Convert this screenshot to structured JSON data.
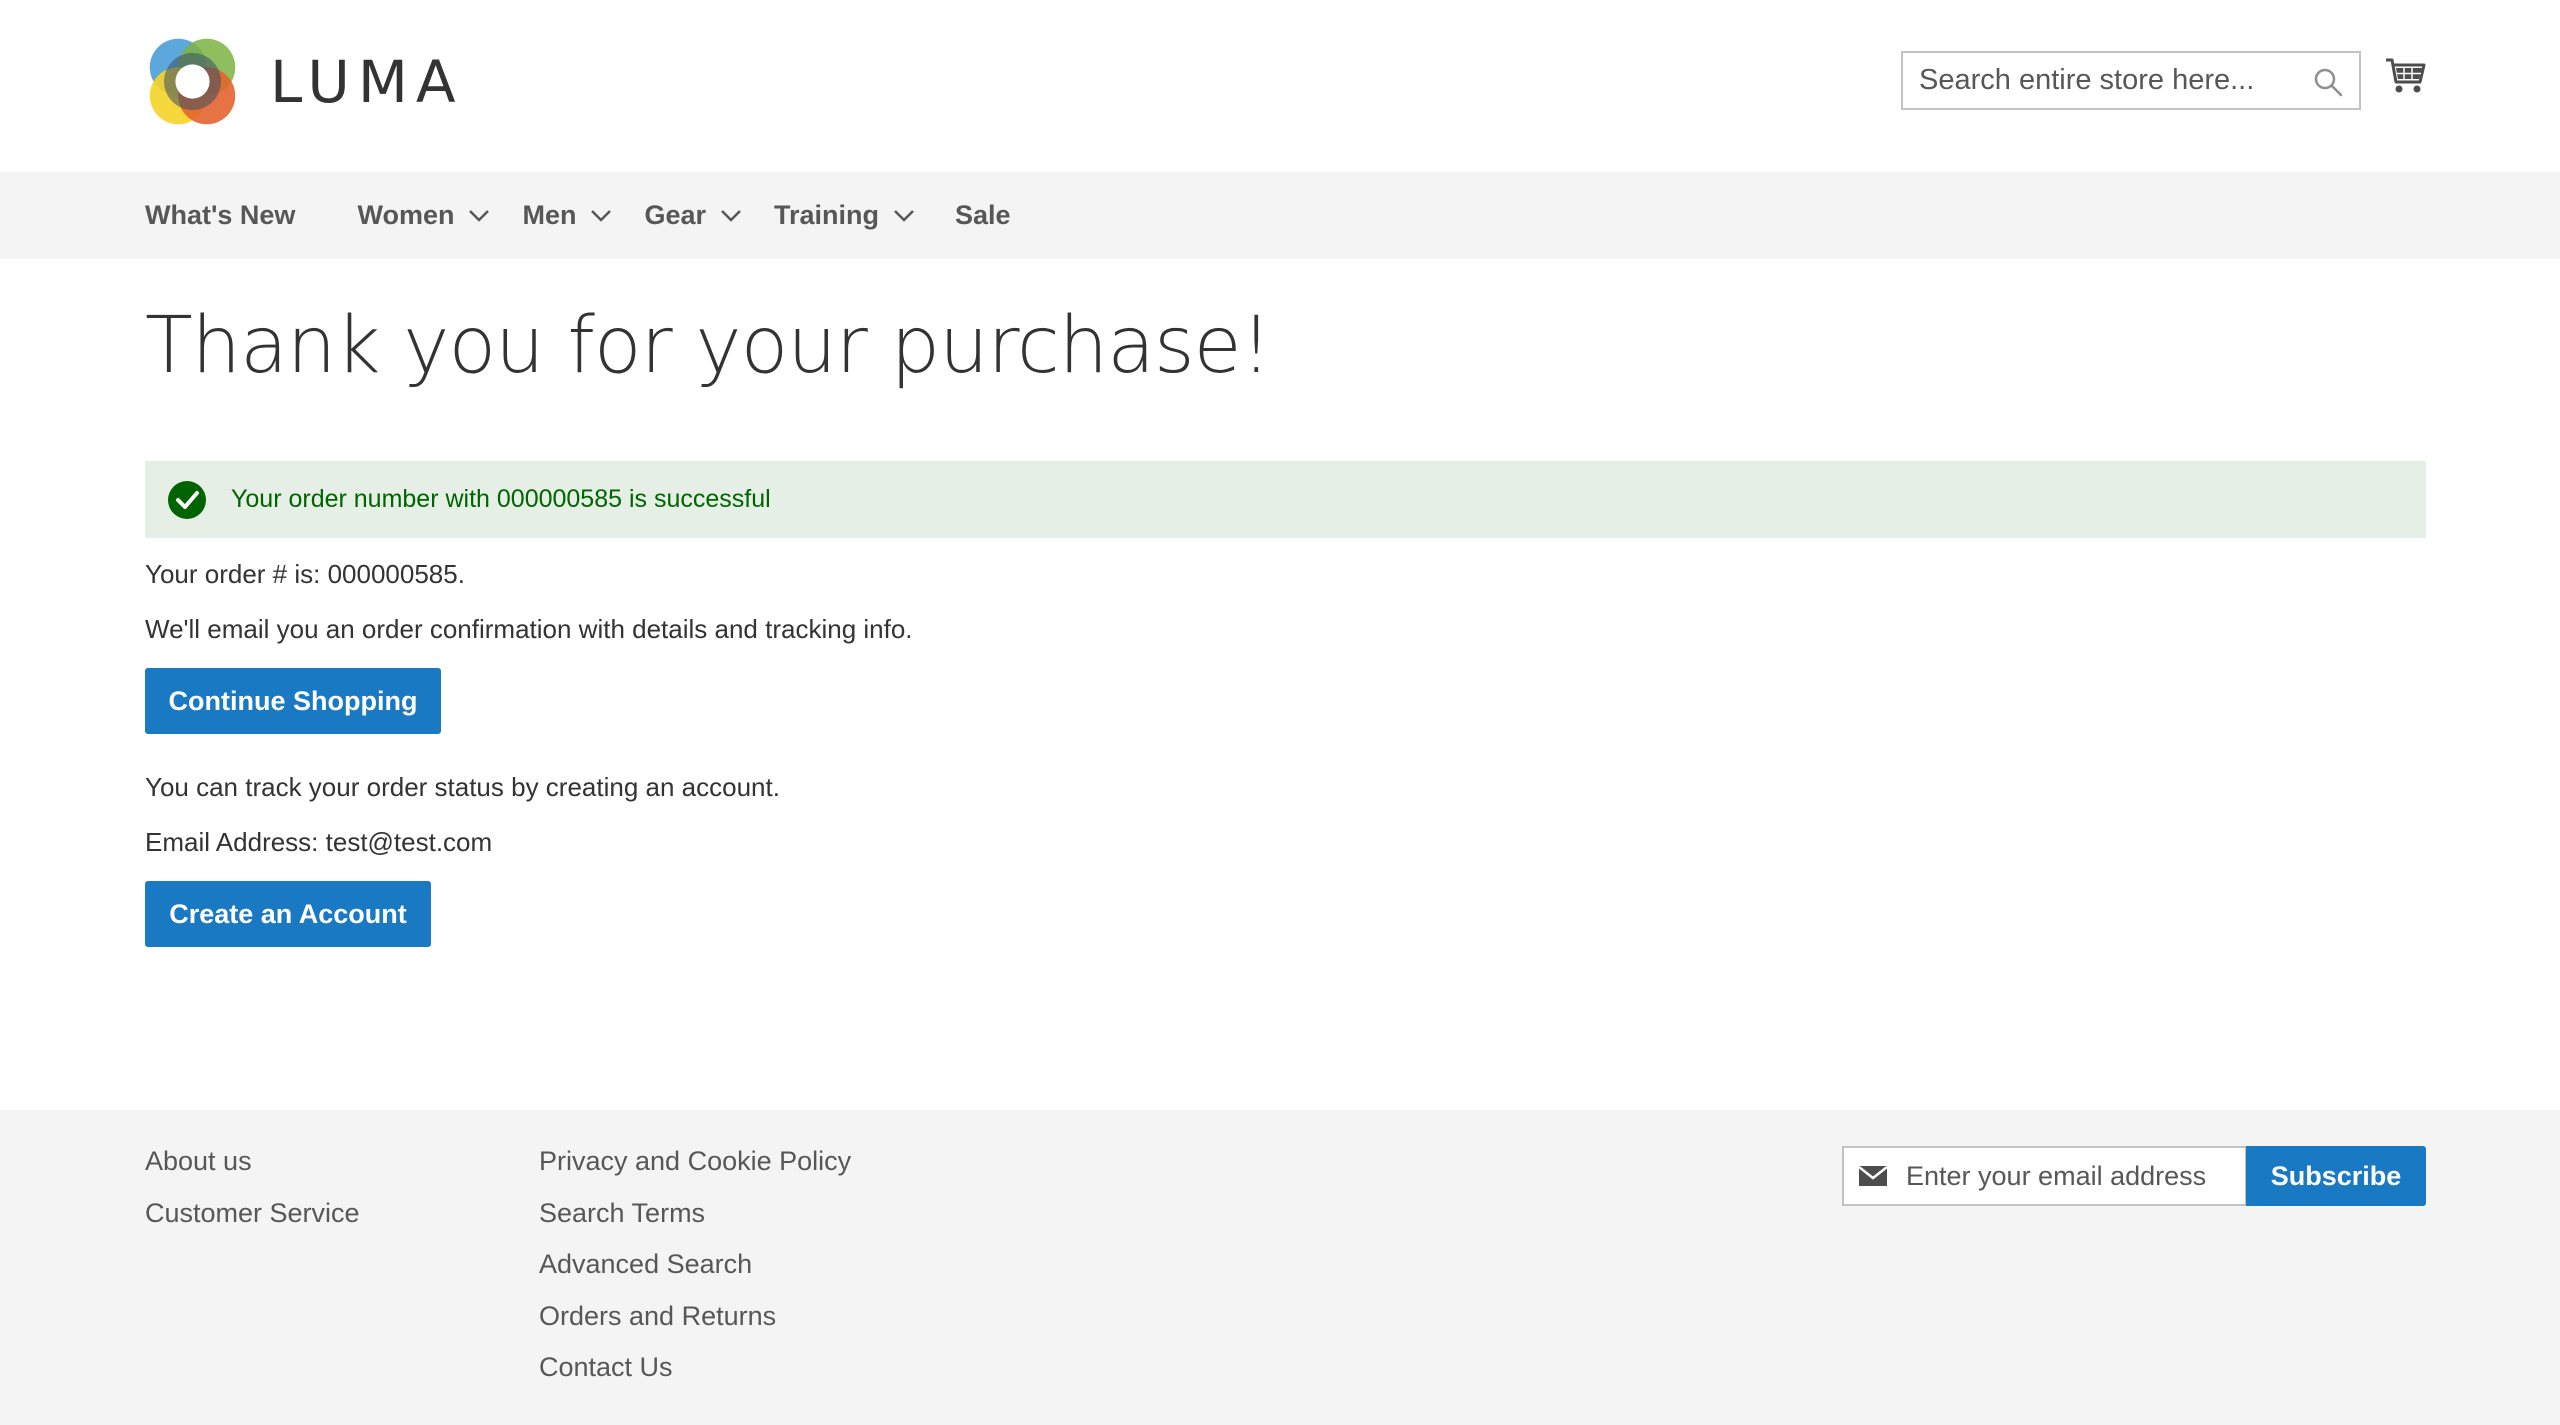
{
  "brand": {
    "name": "LUMA"
  },
  "header": {
    "search_placeholder": "Search entire store here...",
    "search_icon": "search-icon",
    "cart_icon": "cart-icon"
  },
  "nav": {
    "items": [
      {
        "label": "What's New",
        "has_dropdown": false
      },
      {
        "label": "Women",
        "has_dropdown": true
      },
      {
        "label": "Men",
        "has_dropdown": true
      },
      {
        "label": "Gear",
        "has_dropdown": true
      },
      {
        "label": "Training",
        "has_dropdown": true
      },
      {
        "label": "Sale",
        "has_dropdown": false
      }
    ]
  },
  "main": {
    "title": "Thank you for your purchase!",
    "success_message": "Your order number with 000000585 is successful",
    "order_line": "Your order # is: 000000585.",
    "email_note": "We'll email you an order confirmation with details and tracking info.",
    "continue_button": "Continue Shopping",
    "track_note": "You can track your order status by creating an account.",
    "email_line": "Email Address: test@test.com",
    "create_account_button": "Create an Account"
  },
  "footer": {
    "col1": [
      "About us",
      "Customer Service"
    ],
    "col2": [
      "Privacy and Cookie Policy",
      "Search Terms",
      "Advanced Search",
      "Orders and Returns",
      "Contact Us"
    ],
    "newsletter_placeholder": "Enter your email address",
    "subscribe_label": "Subscribe"
  },
  "colors": {
    "accent": "#1979c3",
    "success_bg": "#e5efe5",
    "success_text": "#006400",
    "nav_bg": "#f4f4f4"
  }
}
